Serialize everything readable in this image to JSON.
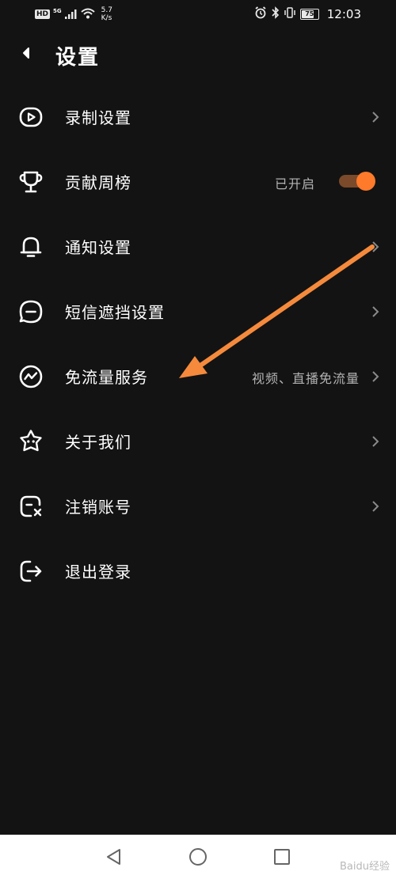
{
  "status_bar": {
    "hd": "HD",
    "network": "5G",
    "speed_value": "5.7",
    "speed_unit": "K/s",
    "battery": "75",
    "battery_level": 0.75,
    "time": "12:03"
  },
  "header": {
    "title": "设置"
  },
  "settings": {
    "items": [
      {
        "label": "录制设置",
        "icon": "record-icon",
        "value": "",
        "has_chevron": true
      },
      {
        "label": "贡献周榜",
        "icon": "trophy-icon",
        "value": "已开启",
        "toggle_on": true
      },
      {
        "label": "通知设置",
        "icon": "bell-icon",
        "value": "",
        "has_chevron": true
      },
      {
        "label": "短信遮挡设置",
        "icon": "message-icon",
        "value": "",
        "has_chevron": true
      },
      {
        "label": "免流量服务",
        "icon": "trend-icon",
        "value": "视频、直播免流量",
        "has_chevron": true
      },
      {
        "label": "关于我们",
        "icon": "star-face-icon",
        "value": "",
        "has_chevron": true
      },
      {
        "label": "注销账号",
        "icon": "cancel-account-icon",
        "value": "",
        "has_chevron": true
      },
      {
        "label": "退出登录",
        "icon": "logout-icon",
        "value": "",
        "has_chevron": false
      }
    ]
  },
  "colors": {
    "background": "#131313",
    "accent": "#ff7a2a",
    "text": "#ffffff",
    "secondary_text": "#b3b3b3"
  },
  "nav_bar": {
    "back": "triangle-back-icon",
    "home": "circle-home-icon",
    "recents": "square-recents-icon"
  },
  "watermark": "Baidu经验"
}
